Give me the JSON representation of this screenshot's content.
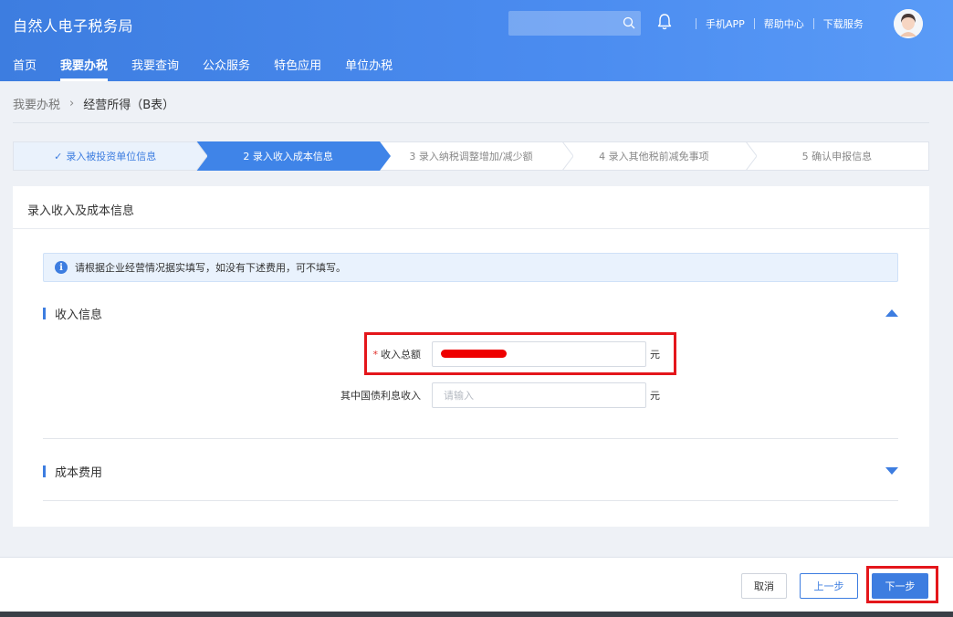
{
  "header": {
    "app_title": "自然人电子税务局",
    "search_placeholder": "",
    "links": [
      "手机APP",
      "帮助中心",
      "下载服务"
    ]
  },
  "nav": {
    "items": [
      "首页",
      "我要办税",
      "我要查询",
      "公众服务",
      "特色应用",
      "单位办税"
    ],
    "active_index": 1
  },
  "breadcrumb": {
    "parent": "我要办税",
    "current": "经营所得（B表）"
  },
  "steps": [
    {
      "label": "录入被投资单位信息",
      "state": "done"
    },
    {
      "label": "2  录入收入成本信息",
      "state": "active"
    },
    {
      "label": "3  录入纳税调整增加/减少额",
      "state": "pending"
    },
    {
      "label": "4  录入其他税前减免事项",
      "state": "pending"
    },
    {
      "label": "5  确认申报信息",
      "state": "pending"
    }
  ],
  "panel": {
    "title": "录入收入及成本信息",
    "notice": "请根据企业经营情况据实填写，如没有下述费用，可不填写。",
    "income_section": {
      "title": "收入信息",
      "expanded": true,
      "fields": [
        {
          "label": "收入总额",
          "required": true,
          "value": "",
          "placeholder": "",
          "unit": "元",
          "redacted": true
        },
        {
          "label": "其中国债利息收入",
          "required": false,
          "value": "",
          "placeholder": "请输入",
          "unit": "元",
          "redacted": false
        }
      ]
    },
    "cost_section": {
      "title": "成本费用",
      "expanded": false
    }
  },
  "footer": {
    "cancel_label": "取消",
    "prev_label": "上一步",
    "next_label": "下一步"
  },
  "colors": {
    "primary": "#3d7de0",
    "highlight": "#e4161b",
    "required": "#e0302a"
  }
}
